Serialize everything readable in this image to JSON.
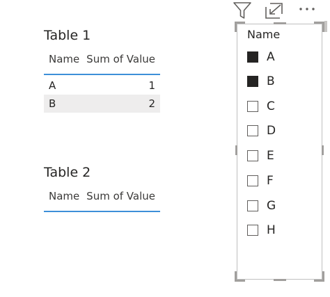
{
  "table1": {
    "title": "Table 1",
    "headers": [
      "Name",
      "Sum of Value"
    ],
    "rows": [
      {
        "name": "A",
        "value": "1"
      },
      {
        "name": "B",
        "value": "2"
      }
    ]
  },
  "table2": {
    "title": "Table 2",
    "headers": [
      "Name",
      "Sum of Value"
    ],
    "rows": []
  },
  "toolbar": {
    "icons": [
      "filter-icon",
      "focus-mode-icon",
      "more-options-icon"
    ]
  },
  "slicer": {
    "header": "Name",
    "items": [
      {
        "label": "A",
        "checked": true
      },
      {
        "label": "B",
        "checked": true
      },
      {
        "label": "C",
        "checked": false
      },
      {
        "label": "D",
        "checked": false
      },
      {
        "label": "E",
        "checked": false
      },
      {
        "label": "F",
        "checked": false
      },
      {
        "label": "G",
        "checked": false
      },
      {
        "label": "H",
        "checked": false
      }
    ]
  },
  "colors": {
    "header_underline": "#3d8fd8",
    "alt_row": "#eeeded",
    "checkbox_checked": "#252423"
  }
}
